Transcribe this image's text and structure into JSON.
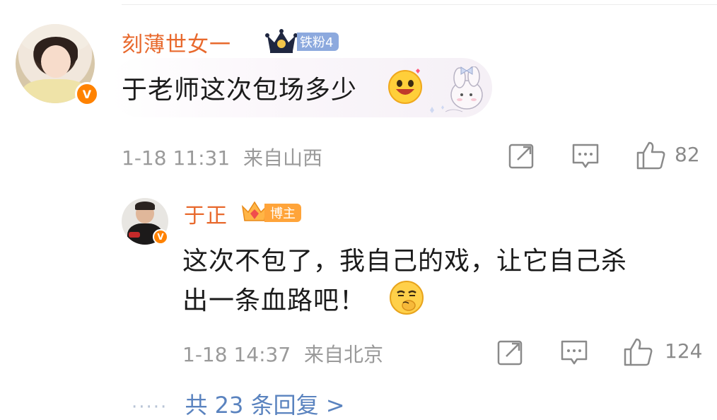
{
  "comment": {
    "username": "刻薄世女一",
    "fan_badge": "铁粉4",
    "text": "于老师这次包场多少",
    "time": "1-18 11:31",
    "location": "来自山西",
    "likes": "82",
    "verified_mark": "V"
  },
  "reply": {
    "username": "于正",
    "host_badge": "博主",
    "text_line1": "这次不包了，我自己的戏，让它自己杀",
    "text_line2": "出一条血路吧！",
    "time": "1-18 14:37",
    "location": "来自北京",
    "likes": "124",
    "verified_mark": "V"
  },
  "more_replies": {
    "dots": "·····",
    "label": "共 23 条回复 >"
  },
  "icons": {
    "repost": "repost-icon",
    "comment": "comment-icon",
    "like": "thumbs-up-icon"
  },
  "colors": {
    "username": "#e8692d",
    "meta": "#9a9a9a",
    "link": "#5a83bf",
    "verified": "#ff8200",
    "fan_badge": "#8ca9de",
    "host_badge": "#ffa43a"
  }
}
